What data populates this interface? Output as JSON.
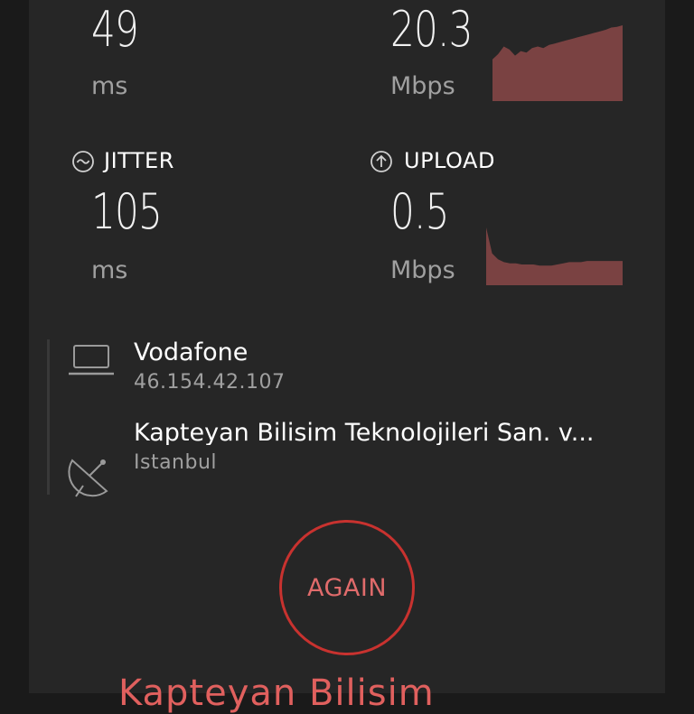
{
  "ping": {
    "value": "49",
    "unit": "ms"
  },
  "download": {
    "value": "20.3",
    "unit": "Mbps",
    "graph": [
      0.55,
      0.62,
      0.72,
      0.68,
      0.6,
      0.66,
      0.64,
      0.7,
      0.72,
      0.7,
      0.74,
      0.76,
      0.78,
      0.8,
      0.82,
      0.84,
      0.86,
      0.88,
      0.9,
      0.92,
      0.94,
      0.97,
      0.98,
      1.0
    ]
  },
  "jitter": {
    "label": "JITTER",
    "value": "105",
    "unit": "ms"
  },
  "upload": {
    "label": "UPLOAD",
    "value": "0.5",
    "unit": "Mbps",
    "graph": [
      1.0,
      0.55,
      0.45,
      0.4,
      0.38,
      0.38,
      0.36,
      0.36,
      0.36,
      0.34,
      0.34,
      0.34,
      0.36,
      0.38,
      0.4,
      0.4,
      0.4,
      0.42,
      0.42,
      0.42,
      0.42,
      0.42,
      0.42,
      0.42
    ]
  },
  "isp": {
    "name": "Vodafone",
    "ip": "46.154.42.107"
  },
  "server": {
    "name": "Kapteyan Bilisim Teknolojileri San. v...",
    "location": "Istanbul"
  },
  "again_button": "AGAIN",
  "footer": {
    "sponsor": "Kapteyan Bilisim"
  },
  "colors": {
    "accent": "#c8322f",
    "graph_fill": "#7a4242"
  }
}
